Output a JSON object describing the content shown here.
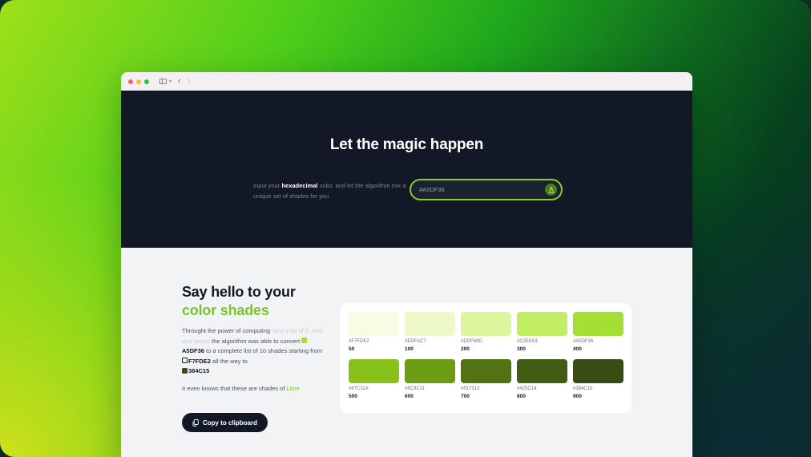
{
  "hero": {
    "title": "Let the magic happen",
    "desc_prefix": "Input your ",
    "desc_bold": "hexadecimal",
    "desc_suffix": " color, and let the algorithm mix a unique set of shades for you",
    "input_value": "#A5DF36"
  },
  "section": {
    "heading_line1": "Say hello to your",
    "heading_line2": "color shades",
    "para_1": "Throught the power of computing ",
    "para_muted": "(and a lot of if, else and loops)",
    "para_2": " the algorithm was able to convert ",
    "base_hex": "A5DF36",
    "para_3": " to a complete list of 10 shades starting from ",
    "start_hex": "F7FDE2",
    "para_4": " all the way to ",
    "end_hex": "384C15",
    "lime_prefix": "It even knows that these are shades of ",
    "lime_name": "Lime",
    "copy_label": "Copy to clipboard"
  },
  "shades": [
    {
      "hex": "#F7FDE2",
      "label": "50",
      "color": "#F7FDE2"
    },
    {
      "hex": "#EDFAC7",
      "label": "100",
      "color": "#EDFAC7"
    },
    {
      "hex": "#DDF69D",
      "label": "200",
      "color": "#DDF69D"
    },
    {
      "hex": "#C2EE63",
      "label": "300",
      "color": "#C2EE63"
    },
    {
      "hex": "#A5DF36",
      "label": "400",
      "color": "#A5DF36"
    },
    {
      "hex": "#87C11A",
      "label": "500",
      "color": "#87C11A"
    },
    {
      "hex": "#6C9C11",
      "label": "600",
      "color": "#6C9C11"
    },
    {
      "hex": "#517312",
      "label": "700",
      "color": "#517312"
    },
    {
      "hex": "#425C14",
      "label": "800",
      "color": "#425C14"
    },
    {
      "hex": "#384C15",
      "label": "900",
      "color": "#384C15"
    }
  ],
  "colors": {
    "accent": "#7CC42E",
    "dark": "#121826"
  },
  "icons": {
    "window_controls": [
      "close-dot",
      "minimize-dot",
      "zoom-dot"
    ],
    "toolbar": [
      "sidebar-icon",
      "chevron-down-icon",
      "back-arrow-icon",
      "forward-arrow-icon"
    ],
    "input_action": "flask-icon",
    "copy": "copy-icon"
  }
}
